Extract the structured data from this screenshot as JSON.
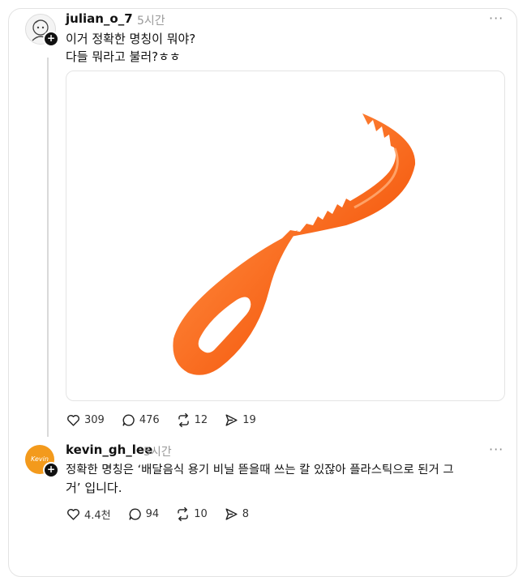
{
  "post": {
    "username": "julian_o_7",
    "time": "5시간",
    "more": "···",
    "lines": [
      "이거 정확한 명칭이 뭐야?",
      "다들 뭐라고 불러?ㅎㅎ"
    ],
    "image_icon": "orange-plastic-cutter",
    "stats": {
      "likes": "309",
      "comments": "476",
      "reposts": "12",
      "shares": "19"
    }
  },
  "reply": {
    "username": "kevin_gh_lee",
    "time": "5시간",
    "more": "···",
    "avatar_text": "Kevin",
    "lines": [
      "정확한 명칭은 ‘배달음식 용기 비닐 뜯을때 쓰는 칼 있잖아 플라스틱으로 된거 그",
      "거’ 입니다."
    ],
    "stats": {
      "likes": "4.4천",
      "comments": "94",
      "reposts": "10",
      "shares": "8"
    }
  },
  "colors": {
    "accent_orange": "#fb6a17",
    "reply_avatar": "#f39a1c",
    "text": "#111111",
    "muted": "#999999"
  }
}
